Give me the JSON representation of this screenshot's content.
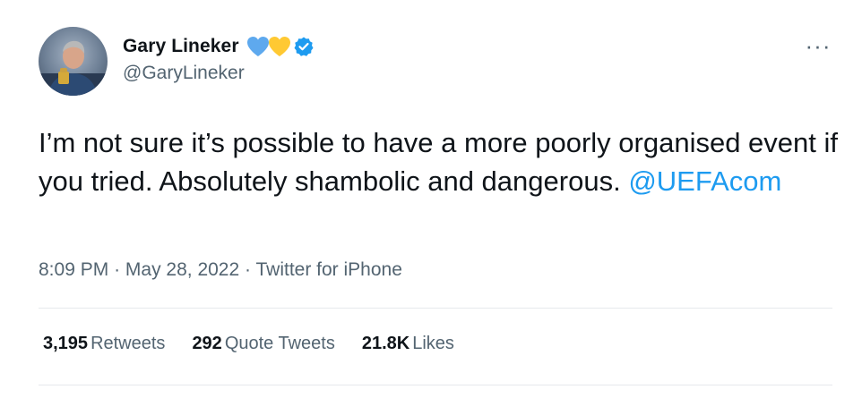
{
  "author": {
    "display_name": "Gary Lineker",
    "handle": "@GaryLineker",
    "hearts": [
      "blue-heart",
      "yellow-heart"
    ],
    "verified_icon": "verified-badge-icon"
  },
  "menu_icon": "more-options-icon",
  "tweet": {
    "text_before": "I’m not sure it’s possible to have a more poorly organised event if you tried. Absolutely shambolic and dangerous.",
    "mention": "@UEFAcom"
  },
  "meta": {
    "time": "8:09 PM",
    "date": "May 28, 2022",
    "source": "Twitter for iPhone",
    "separator": "·"
  },
  "stats": {
    "retweets_count": "3,195",
    "retweets_label": "Retweets",
    "quotes_count": "292",
    "quotes_label": "Quote Tweets",
    "likes_count": "21.8K",
    "likes_label": "Likes"
  },
  "colors": {
    "text": "#0f1419",
    "secondary": "#536471",
    "link": "#1d9bf0",
    "blue_heart": "#5ea9ee",
    "yellow_heart": "#ffc933"
  }
}
